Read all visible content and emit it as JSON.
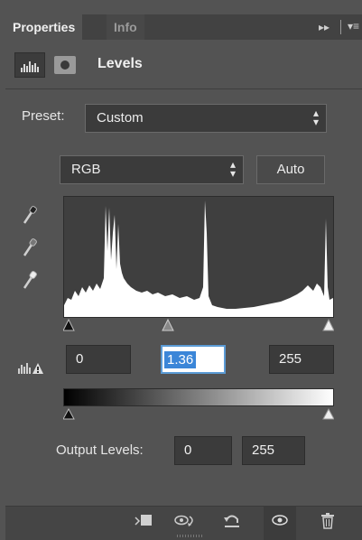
{
  "tabs": [
    {
      "label": "Properties",
      "active": true
    },
    {
      "label": "Info",
      "active": false
    }
  ],
  "tab_tools": {
    "forward_glyph": "▸▸",
    "menu_glyph": "▾≡"
  },
  "header": {
    "title": "Levels",
    "icons": [
      "levels-adjustment-icon",
      "layer-mask-icon"
    ]
  },
  "preset": {
    "label": "Preset:",
    "value": "Custom"
  },
  "channel": {
    "value": "RGB"
  },
  "auto_button": {
    "label": "Auto"
  },
  "eyedroppers": [
    "black-point-eyedropper-icon",
    "gray-point-eyedropper-icon",
    "white-point-eyedropper-icon"
  ],
  "input_levels": {
    "black": "0",
    "gamma": "1.36",
    "white": "255"
  },
  "output_levels": {
    "label": "Output Levels:",
    "black": "0",
    "white": "255"
  },
  "toolbar_icons": [
    "clip-to-layer-icon",
    "view-previous-state-icon",
    "reset-icon",
    "toggle-visibility-icon",
    "delete-icon"
  ],
  "colors": {
    "panel": "#535353",
    "field": "#3b3b3b",
    "highlight": "#3b86d8"
  }
}
